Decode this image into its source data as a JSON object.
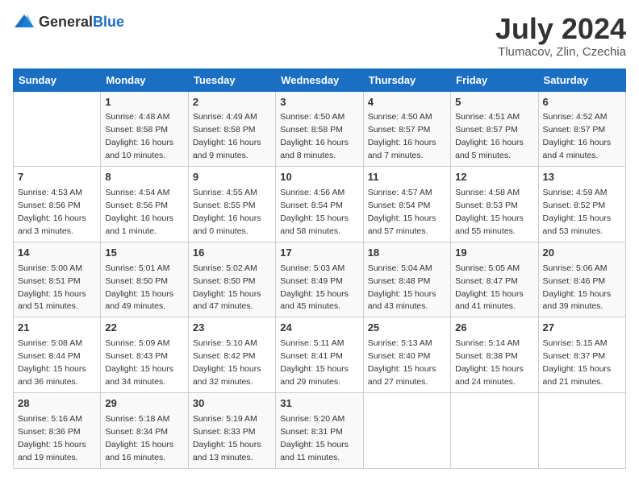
{
  "header": {
    "logo_general": "General",
    "logo_blue": "Blue",
    "month": "July 2024",
    "location": "Tlumacov, Zlin, Czechia"
  },
  "days_of_week": [
    "Sunday",
    "Monday",
    "Tuesday",
    "Wednesday",
    "Thursday",
    "Friday",
    "Saturday"
  ],
  "weeks": [
    [
      {
        "day": "",
        "info": ""
      },
      {
        "day": "1",
        "info": "Sunrise: 4:48 AM\nSunset: 8:58 PM\nDaylight: 16 hours and 10 minutes."
      },
      {
        "day": "2",
        "info": "Sunrise: 4:49 AM\nSunset: 8:58 PM\nDaylight: 16 hours and 9 minutes."
      },
      {
        "day": "3",
        "info": "Sunrise: 4:50 AM\nSunset: 8:58 PM\nDaylight: 16 hours and 8 minutes."
      },
      {
        "day": "4",
        "info": "Sunrise: 4:50 AM\nSunset: 8:57 PM\nDaylight: 16 hours and 7 minutes."
      },
      {
        "day": "5",
        "info": "Sunrise: 4:51 AM\nSunset: 8:57 PM\nDaylight: 16 hours and 5 minutes."
      },
      {
        "day": "6",
        "info": "Sunrise: 4:52 AM\nSunset: 8:57 PM\nDaylight: 16 hours and 4 minutes."
      }
    ],
    [
      {
        "day": "7",
        "info": "Sunrise: 4:53 AM\nSunset: 8:56 PM\nDaylight: 16 hours and 3 minutes."
      },
      {
        "day": "8",
        "info": "Sunrise: 4:54 AM\nSunset: 8:56 PM\nDaylight: 16 hours and 1 minute."
      },
      {
        "day": "9",
        "info": "Sunrise: 4:55 AM\nSunset: 8:55 PM\nDaylight: 16 hours and 0 minutes."
      },
      {
        "day": "10",
        "info": "Sunrise: 4:56 AM\nSunset: 8:54 PM\nDaylight: 15 hours and 58 minutes."
      },
      {
        "day": "11",
        "info": "Sunrise: 4:57 AM\nSunset: 8:54 PM\nDaylight: 15 hours and 57 minutes."
      },
      {
        "day": "12",
        "info": "Sunrise: 4:58 AM\nSunset: 8:53 PM\nDaylight: 15 hours and 55 minutes."
      },
      {
        "day": "13",
        "info": "Sunrise: 4:59 AM\nSunset: 8:52 PM\nDaylight: 15 hours and 53 minutes."
      }
    ],
    [
      {
        "day": "14",
        "info": "Sunrise: 5:00 AM\nSunset: 8:51 PM\nDaylight: 15 hours and 51 minutes."
      },
      {
        "day": "15",
        "info": "Sunrise: 5:01 AM\nSunset: 8:50 PM\nDaylight: 15 hours and 49 minutes."
      },
      {
        "day": "16",
        "info": "Sunrise: 5:02 AM\nSunset: 8:50 PM\nDaylight: 15 hours and 47 minutes."
      },
      {
        "day": "17",
        "info": "Sunrise: 5:03 AM\nSunset: 8:49 PM\nDaylight: 15 hours and 45 minutes."
      },
      {
        "day": "18",
        "info": "Sunrise: 5:04 AM\nSunset: 8:48 PM\nDaylight: 15 hours and 43 minutes."
      },
      {
        "day": "19",
        "info": "Sunrise: 5:05 AM\nSunset: 8:47 PM\nDaylight: 15 hours and 41 minutes."
      },
      {
        "day": "20",
        "info": "Sunrise: 5:06 AM\nSunset: 8:46 PM\nDaylight: 15 hours and 39 minutes."
      }
    ],
    [
      {
        "day": "21",
        "info": "Sunrise: 5:08 AM\nSunset: 8:44 PM\nDaylight: 15 hours and 36 minutes."
      },
      {
        "day": "22",
        "info": "Sunrise: 5:09 AM\nSunset: 8:43 PM\nDaylight: 15 hours and 34 minutes."
      },
      {
        "day": "23",
        "info": "Sunrise: 5:10 AM\nSunset: 8:42 PM\nDaylight: 15 hours and 32 minutes."
      },
      {
        "day": "24",
        "info": "Sunrise: 5:11 AM\nSunset: 8:41 PM\nDaylight: 15 hours and 29 minutes."
      },
      {
        "day": "25",
        "info": "Sunrise: 5:13 AM\nSunset: 8:40 PM\nDaylight: 15 hours and 27 minutes."
      },
      {
        "day": "26",
        "info": "Sunrise: 5:14 AM\nSunset: 8:38 PM\nDaylight: 15 hours and 24 minutes."
      },
      {
        "day": "27",
        "info": "Sunrise: 5:15 AM\nSunset: 8:37 PM\nDaylight: 15 hours and 21 minutes."
      }
    ],
    [
      {
        "day": "28",
        "info": "Sunrise: 5:16 AM\nSunset: 8:36 PM\nDaylight: 15 hours and 19 minutes."
      },
      {
        "day": "29",
        "info": "Sunrise: 5:18 AM\nSunset: 8:34 PM\nDaylight: 15 hours and 16 minutes."
      },
      {
        "day": "30",
        "info": "Sunrise: 5:19 AM\nSunset: 8:33 PM\nDaylight: 15 hours and 13 minutes."
      },
      {
        "day": "31",
        "info": "Sunrise: 5:20 AM\nSunset: 8:31 PM\nDaylight: 15 hours and 11 minutes."
      },
      {
        "day": "",
        "info": ""
      },
      {
        "day": "",
        "info": ""
      },
      {
        "day": "",
        "info": ""
      }
    ]
  ]
}
